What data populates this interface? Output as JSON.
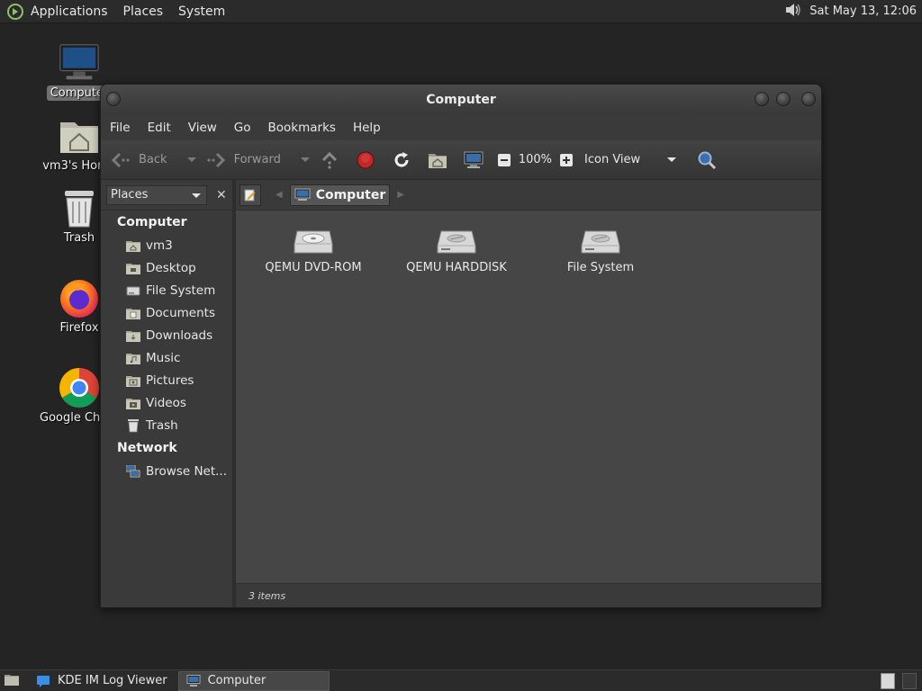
{
  "top_panel": {
    "menus": [
      "Applications",
      "Places",
      "System"
    ],
    "clock": "Sat May 13, 12:06"
  },
  "desktop": {
    "icons": [
      {
        "label": "Computer",
        "icon": "computer-icon"
      },
      {
        "label": "vm3's Home",
        "icon": "home-folder-icon"
      },
      {
        "label": "Trash",
        "icon": "trash-icon"
      },
      {
        "label": "Firefox",
        "icon": "firefox-icon"
      },
      {
        "label": "Google Chrome",
        "icon": "chrome-icon"
      }
    ]
  },
  "window": {
    "title": "Computer",
    "menubar": [
      "File",
      "Edit",
      "View",
      "Go",
      "Bookmarks",
      "Help"
    ],
    "toolbar": {
      "back": "Back",
      "forward": "Forward",
      "zoom": "100%",
      "view_mode": "Icon View"
    },
    "sidebar": {
      "selector": "Places",
      "sections": [
        {
          "title": "Computer",
          "items": [
            {
              "label": "vm3",
              "icon": "home-folder-icon"
            },
            {
              "label": "Desktop",
              "icon": "desktop-folder-icon"
            },
            {
              "label": "File System",
              "icon": "drive-icon"
            },
            {
              "label": "Documents",
              "icon": "folder-icon"
            },
            {
              "label": "Downloads",
              "icon": "folder-icon"
            },
            {
              "label": "Music",
              "icon": "music-folder-icon"
            },
            {
              "label": "Pictures",
              "icon": "pictures-folder-icon"
            },
            {
              "label": "Videos",
              "icon": "videos-folder-icon"
            },
            {
              "label": "Trash",
              "icon": "trash-icon"
            }
          ]
        },
        {
          "title": "Network",
          "items": [
            {
              "label": "Browse Net...",
              "icon": "network-icon"
            }
          ]
        }
      ]
    },
    "location": "Computer",
    "files": [
      {
        "label": "QEMU DVD-ROM",
        "icon": "optical-drive-icon"
      },
      {
        "label": "QEMU HARDDISK",
        "icon": "harddisk-icon"
      },
      {
        "label": "File System",
        "icon": "harddisk-icon"
      }
    ],
    "status": "3 items"
  },
  "taskbar": {
    "tasks": [
      {
        "label": "KDE IM Log Viewer",
        "active": false
      },
      {
        "label": "Computer",
        "active": true
      }
    ]
  },
  "colors": {
    "desktop_bg": "#242424",
    "window_bg": "#3a3a3a",
    "iconview_bg": "#464646",
    "stop_red": "#c0282a"
  }
}
